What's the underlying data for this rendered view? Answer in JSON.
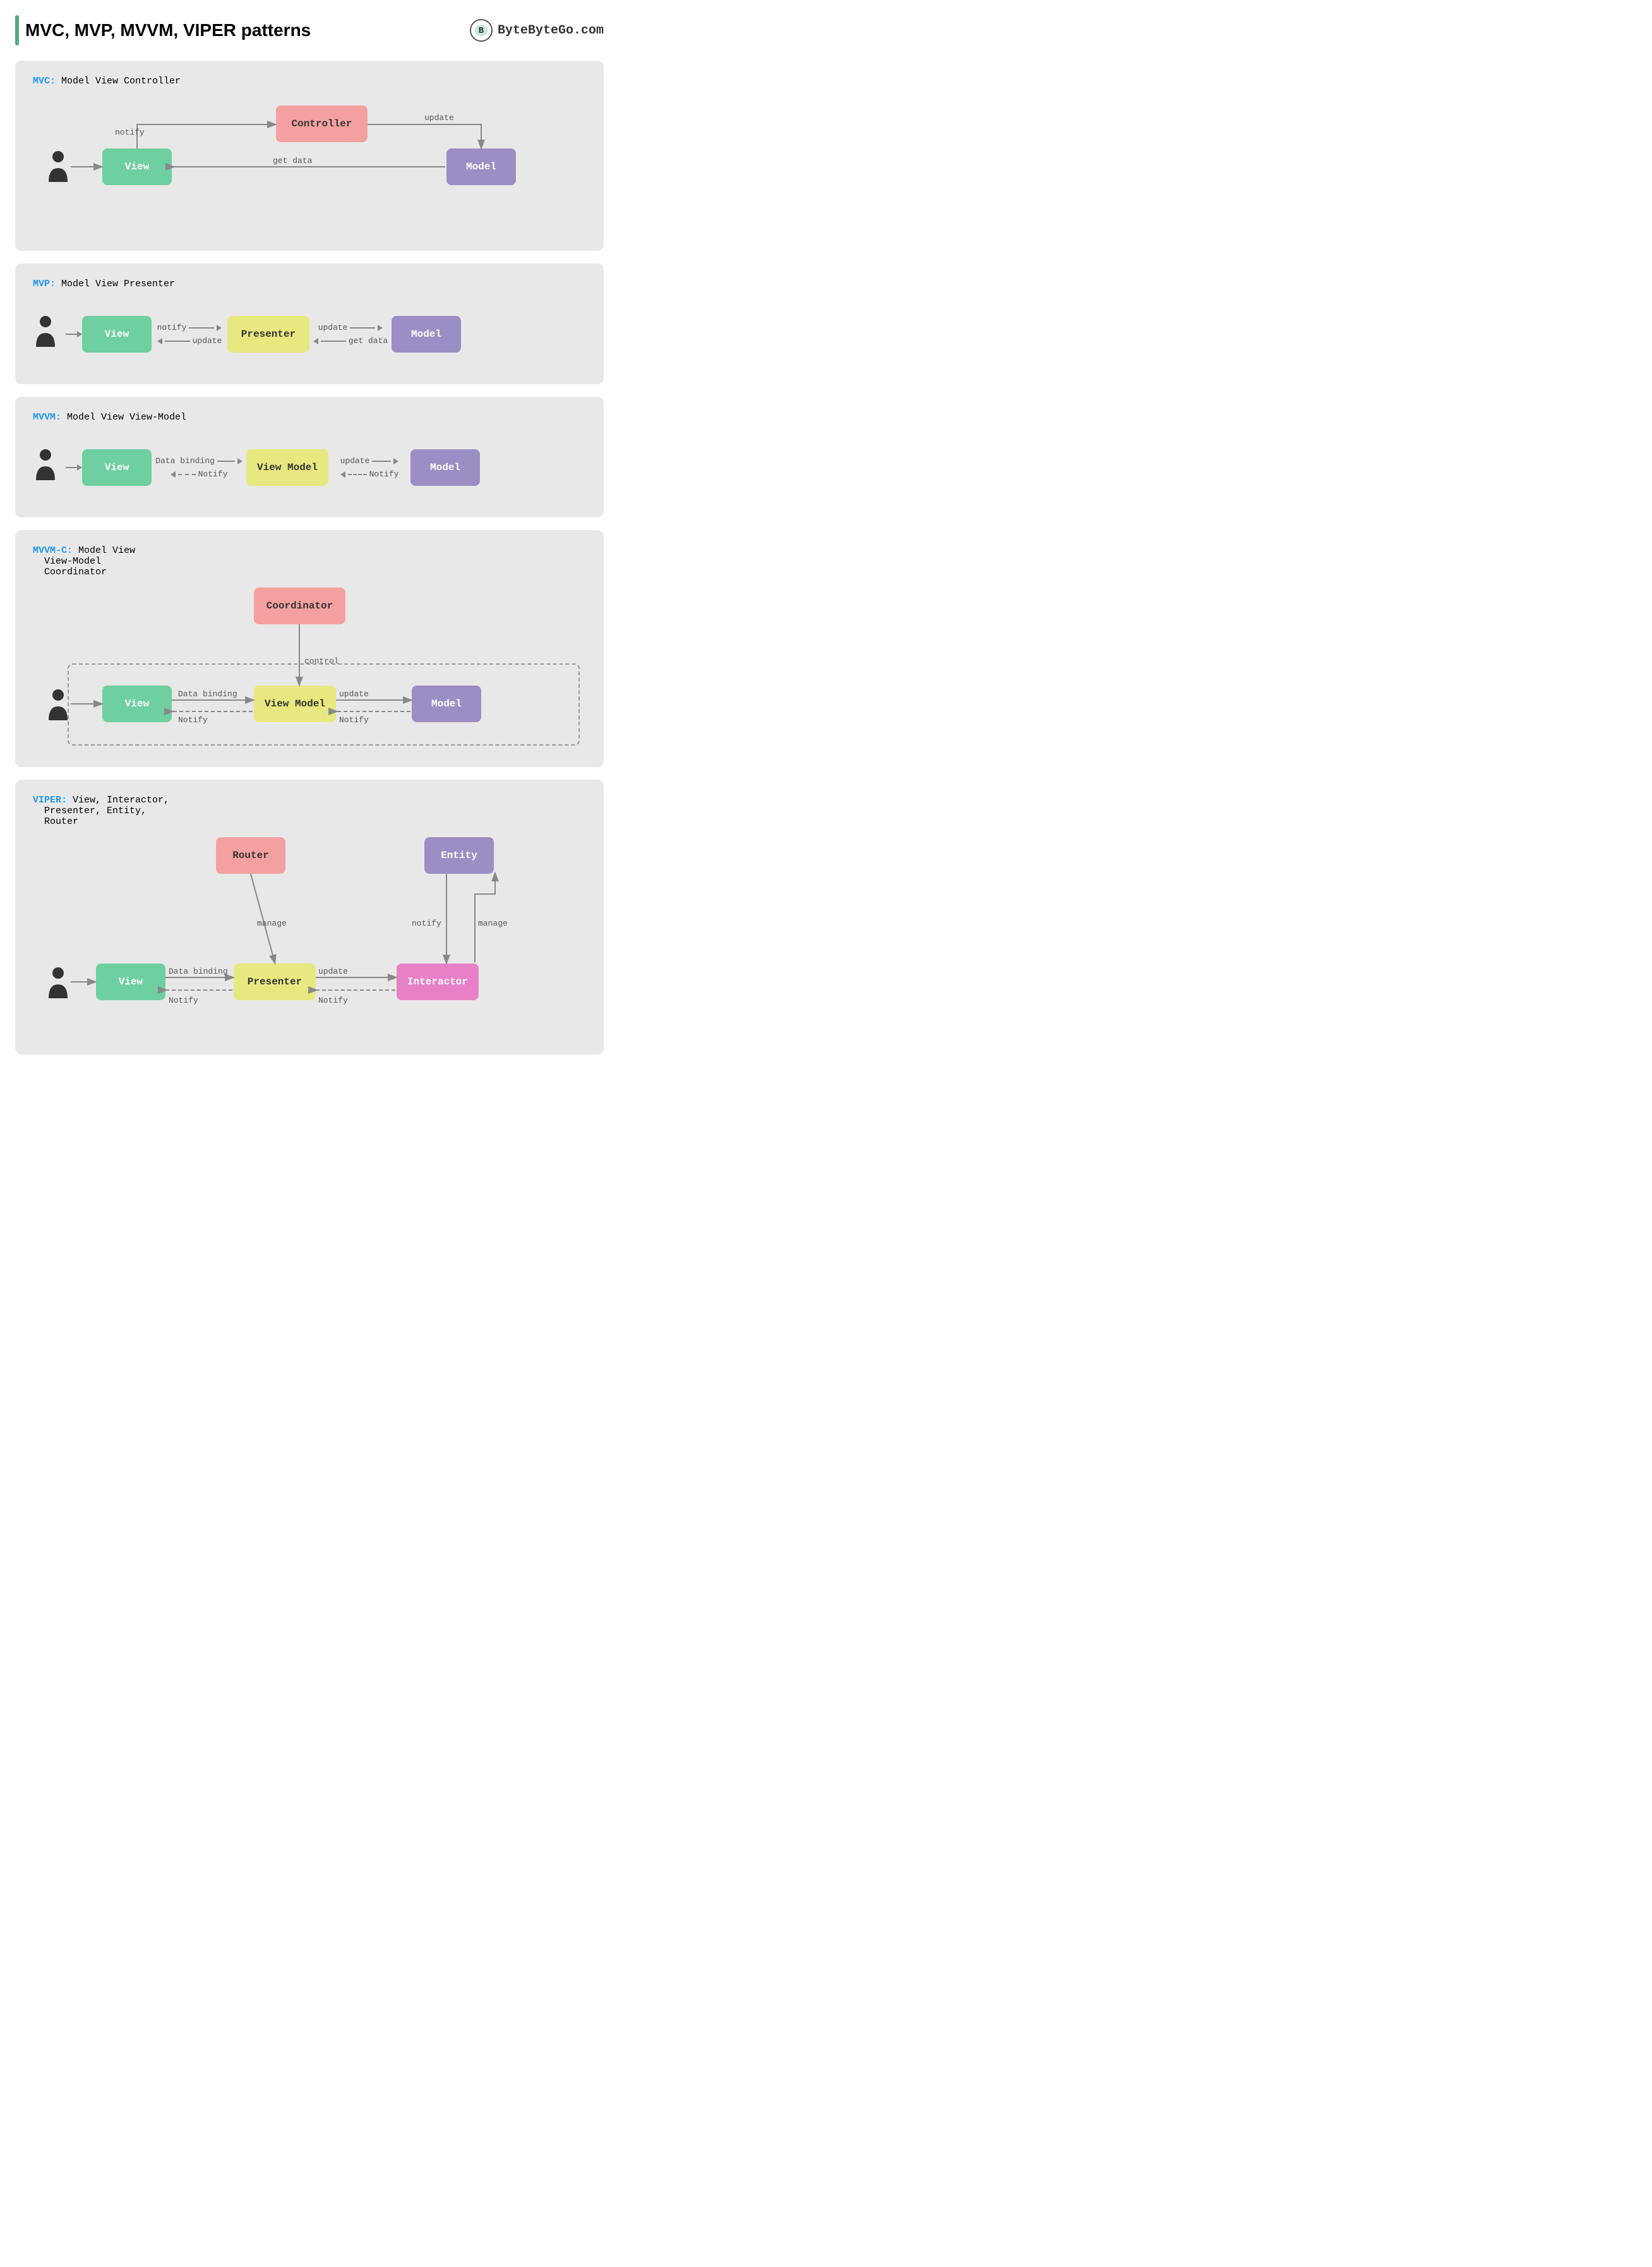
{
  "page": {
    "title": "MVC, MVP, MVVM, VIPER patterns",
    "logo_text": "ByteByteGo.com"
  },
  "patterns": {
    "mvc": {
      "acronym": "MVC:",
      "label": "Model View Controller",
      "view": "View",
      "controller": "Controller",
      "model": "Model",
      "arrow_notify": "notify",
      "arrow_get_data": "get data",
      "arrow_update": "update"
    },
    "mvp": {
      "acronym": "MVP:",
      "label": "Model View Presenter",
      "view": "View",
      "presenter": "Presenter",
      "model": "Model",
      "arrow_notify": "notify",
      "arrow_update_top": "update",
      "arrow_update_bottom": "update",
      "arrow_get_data": "get data"
    },
    "mvvm": {
      "acronym": "MVVM:",
      "label": "Model View View-Model",
      "view": "View",
      "viewmodel": "View Model",
      "model": "Model",
      "arrow_data_binding": "Data binding",
      "arrow_notify": "Notify",
      "arrow_update": "update",
      "arrow_notify2": "Notify"
    },
    "mvvmc": {
      "acronym": "MVVM-C:",
      "label": "Model View\n  View-Model\n  Coordinator",
      "coordinator": "Coordinator",
      "view": "View",
      "viewmodel": "View Model",
      "model": "Model",
      "arrow_control": "control",
      "arrow_data_binding": "Data binding",
      "arrow_notify": "Notify",
      "arrow_update": "update",
      "arrow_notify2": "Notify"
    },
    "viper": {
      "acronym": "VIPER:",
      "label": "View, Interactor,\n  Presenter, Entity,\n  Router",
      "router": "Router",
      "entity": "Entity",
      "view": "View",
      "presenter": "Presenter",
      "interactor": "Interactor",
      "arrow_manage": "manage",
      "arrow_notify": "notify",
      "arrow_manage2": "manage",
      "arrow_data_binding": "Data binding",
      "arrow_notify2": "Notify",
      "arrow_update": "update",
      "arrow_notify3": "Notify"
    }
  }
}
